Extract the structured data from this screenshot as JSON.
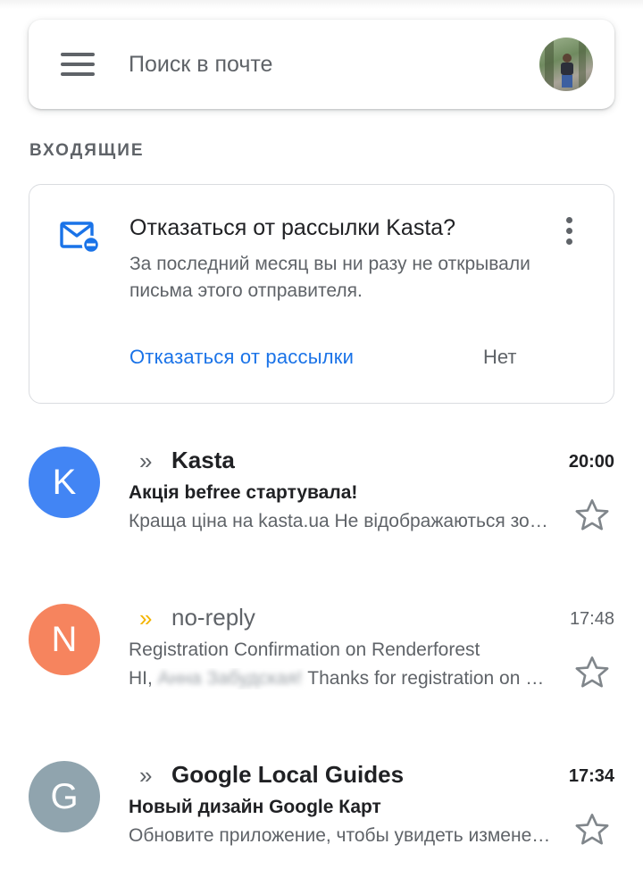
{
  "search": {
    "placeholder": "Поиск в почте"
  },
  "section": {
    "label": "ВХОДЯЩИЕ"
  },
  "unsubscribe_card": {
    "title": "Отказаться от рассылки Kasta?",
    "description": "За последний месяц вы ни разу не открывали письма этого отправителя.",
    "action_label": "Отказаться от рассылки",
    "dismiss_label": "Нет",
    "icon": "mail-unsubscribe-icon",
    "accent_color": "#1a73e8"
  },
  "emails": [
    {
      "avatar_letter": "K",
      "avatar_color": "#4285f4",
      "importance_marker": "»",
      "importance_color": "#5f6368",
      "sender": "Kasta",
      "time": "20:00",
      "unread": true,
      "subject": "Акція befree стартувала!",
      "snippet": "Краща ціна на kasta.ua Не відображаються зображення?",
      "starred": false
    },
    {
      "avatar_letter": "N",
      "avatar_color": "#f6845e",
      "importance_marker": "»",
      "importance_color": "#f4b400",
      "sender": "no-reply",
      "time": "17:48",
      "unread": false,
      "subject": "Registration Confirmation on Renderforest",
      "snippet_prefix": "HI, ",
      "snippet_blurred": "Анна Забудская!",
      "snippet_suffix": " Thanks for registration on Renderforest",
      "starred": false
    },
    {
      "avatar_letter": "G",
      "avatar_color": "#90a4ae",
      "importance_marker": "»",
      "importance_color": "#5f6368",
      "sender": "Google Local Guides",
      "time": "17:34",
      "unread": true,
      "subject": "Новый дизайн Google Карт",
      "snippet": "Обновите приложение, чтобы увидеть изменения",
      "starred": false
    }
  ]
}
